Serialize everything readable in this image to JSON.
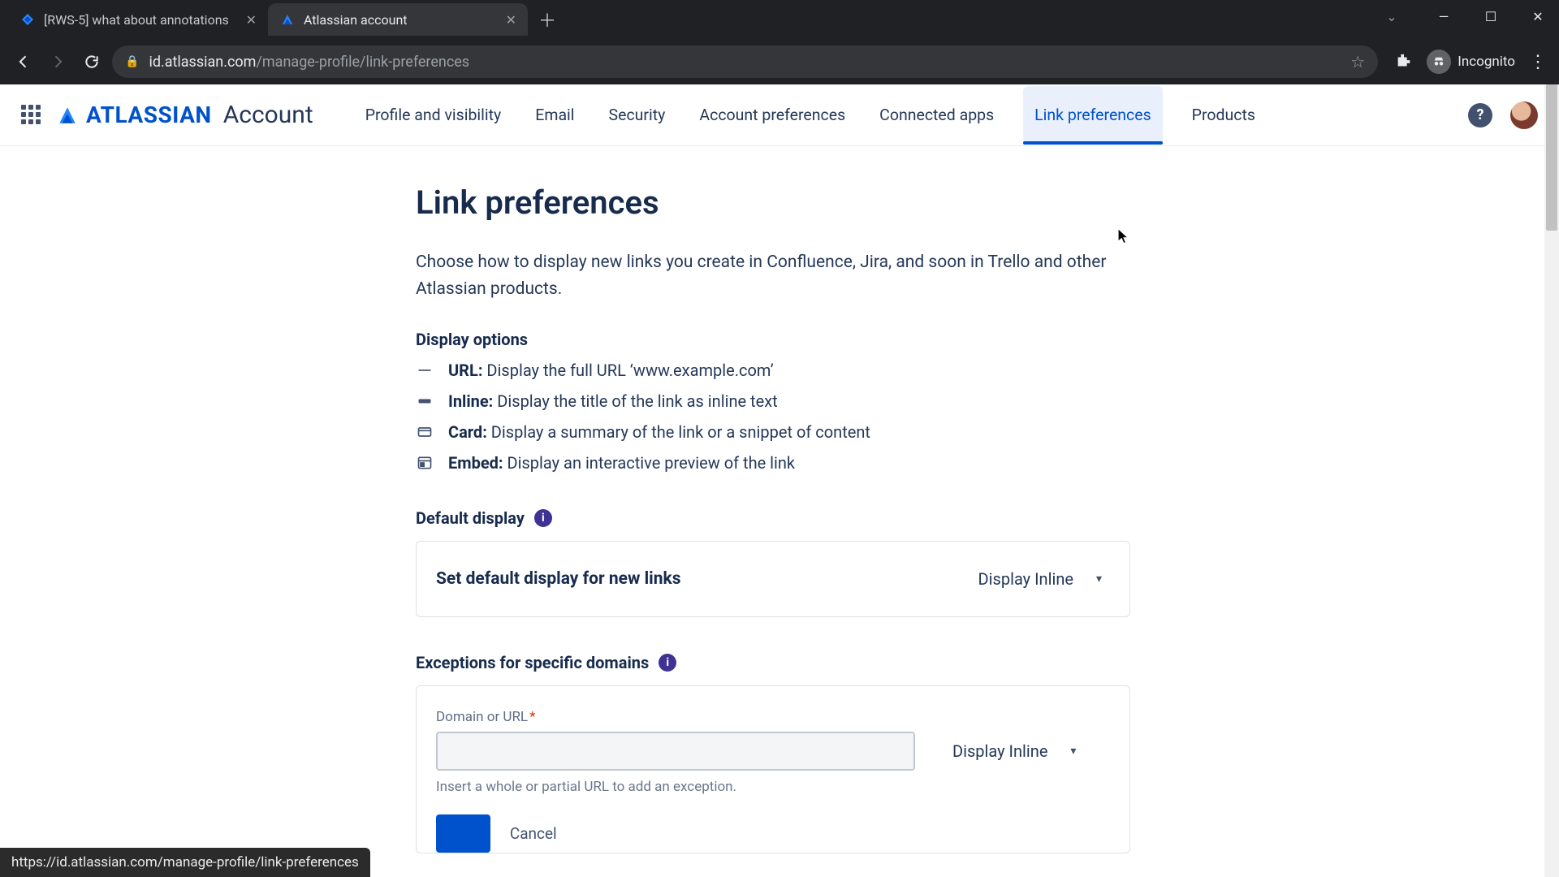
{
  "browser": {
    "tabs": [
      {
        "title": "[RWS-5] what about annotations",
        "active": false
      },
      {
        "title": "Atlassian account",
        "active": true
      }
    ],
    "url_host": "id.atlassian.com",
    "url_path": "/manage-profile/link-preferences",
    "incognito_label": "Incognito",
    "status_url": "https://id.atlassian.com/manage-profile/link-preferences"
  },
  "header": {
    "brand_word": "ATLASSIAN",
    "brand_sub": "Account",
    "nav": [
      {
        "label": "Profile and visibility",
        "active": false
      },
      {
        "label": "Email",
        "active": false
      },
      {
        "label": "Security",
        "active": false
      },
      {
        "label": "Account preferences",
        "active": false
      },
      {
        "label": "Connected apps",
        "active": false
      },
      {
        "label": "Link preferences",
        "active": true
      },
      {
        "label": "Products",
        "active": false
      }
    ],
    "help_glyph": "?"
  },
  "page": {
    "title": "Link preferences",
    "lead": "Choose how to display new links you create in Confluence, Jira, and soon in Trello and other Atlassian products.",
    "display_options_heading": "Display options",
    "options": [
      {
        "name": "URL:",
        "desc": "Display the full URL ‘www.example.com’"
      },
      {
        "name": "Inline:",
        "desc": "Display the title of the link as inline text"
      },
      {
        "name": "Card:",
        "desc": "Display a summary of the link or a snippet of content"
      },
      {
        "name": "Embed:",
        "desc": "Display an interactive preview of the link"
      }
    ],
    "default_display_heading": "Default display",
    "default_display_label": "Set default display for new links",
    "default_display_value": "Display Inline",
    "exceptions_heading": "Exceptions for specific domains",
    "domain_field_label": "Domain or URL",
    "domain_field_required": "*",
    "domain_select_value": "Display Inline",
    "domain_helper": "Insert a whole or partial URL to add an exception.",
    "cancel_label": "Cancel"
  }
}
